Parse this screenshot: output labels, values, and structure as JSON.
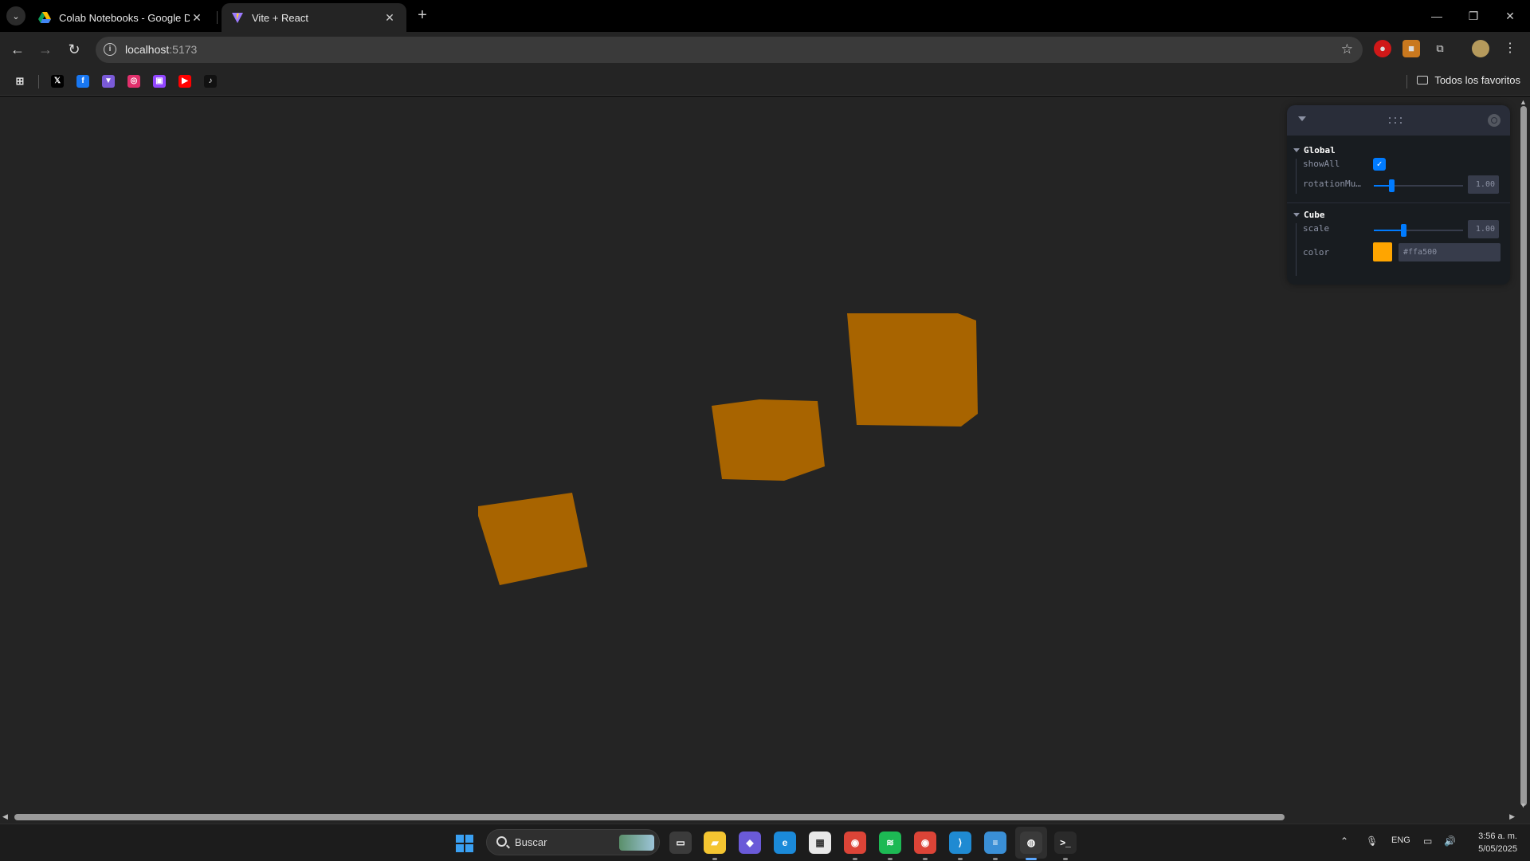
{
  "browser": {
    "tabs": [
      {
        "label": "Colab Notebooks - Google Dri",
        "icon": "google-drive-icon",
        "active": false
      },
      {
        "label": "Vite + React",
        "icon": "vite-icon",
        "active": true
      }
    ],
    "tab_close": "✕",
    "new_tab": "+",
    "window": {
      "minimize": "—",
      "restore": "❐",
      "close": "✕"
    },
    "url_host": "localhost",
    "url_port": ":5173",
    "bookmarks_folder": "Todos los favoritos",
    "bookmarks": [
      {
        "name": "X",
        "icon": "x-icon",
        "color": "#000000",
        "glyph": "𝕏"
      },
      {
        "name": "Facebook",
        "icon": "facebook-icon",
        "color": "#1877f2",
        "glyph": "f"
      },
      {
        "name": "Vimeo-like",
        "icon": "triangle-app-icon",
        "color": "#7a5ad8",
        "glyph": "▼"
      },
      {
        "name": "Instagram",
        "icon": "instagram-icon",
        "color": "#e1306c",
        "glyph": "◎"
      },
      {
        "name": "Twitch",
        "icon": "twitch-icon",
        "color": "#9146ff",
        "glyph": "▣"
      },
      {
        "name": "YouTube",
        "icon": "youtube-icon",
        "color": "#ff0000",
        "glyph": "▶"
      },
      {
        "name": "TikTok",
        "icon": "tiktok-icon",
        "color": "#111111",
        "glyph": "♪"
      }
    ]
  },
  "scene": {
    "cube_color": "#a86400",
    "background": "#242424"
  },
  "leva": {
    "folders": [
      {
        "title": "Global",
        "rows": [
          {
            "label": "showAll",
            "type": "checkbox",
            "checked": true
          },
          {
            "label": "rotationMu…",
            "type": "slider",
            "value": "1.00",
            "fraction": 0.2
          }
        ]
      },
      {
        "title": "Cube",
        "rows": [
          {
            "label": "scale",
            "type": "slider",
            "value": "1.00",
            "fraction": 0.33
          },
          {
            "label": "color",
            "type": "color",
            "value": "#ffa500"
          }
        ]
      }
    ],
    "accent": "#007bff"
  },
  "taskbar": {
    "search_label": "Buscar",
    "apps": [
      {
        "name": "task-view",
        "icon": "task-view-icon",
        "color": "#3b3b3b",
        "glyph": "▭"
      },
      {
        "name": "file-explorer",
        "icon": "folder-icon",
        "color": "#f4c531",
        "glyph": "▰"
      },
      {
        "name": "copilot",
        "icon": "copilot-icon",
        "color": "#6a5ad8",
        "glyph": "◆"
      },
      {
        "name": "edge",
        "icon": "edge-icon",
        "color": "#1b8ad9",
        "glyph": "e"
      },
      {
        "name": "store",
        "icon": "store-icon",
        "color": "#e8e8e8",
        "glyph": "▦"
      },
      {
        "name": "chrome",
        "icon": "chrome-icon",
        "color": "#dc4437",
        "glyph": "◉"
      },
      {
        "name": "spotify",
        "icon": "spotify-icon",
        "color": "#1db954",
        "glyph": "≋"
      },
      {
        "name": "chrome-2",
        "icon": "chrome-icon",
        "color": "#dc4437",
        "glyph": "◉"
      },
      {
        "name": "vscode",
        "icon": "vscode-icon",
        "color": "#1f8ad2",
        "glyph": "⟩"
      },
      {
        "name": "notepad",
        "icon": "notepad-icon",
        "color": "#3a8fd6",
        "glyph": "≡"
      },
      {
        "name": "obs",
        "icon": "obs-icon",
        "color": "#3a3a3a",
        "glyph": "◍"
      },
      {
        "name": "terminal",
        "icon": "terminal-icon",
        "color": "#2a2a2a",
        "glyph": ">_"
      }
    ],
    "tray": {
      "lang": "ENG"
    },
    "time": "3:56 a. m.",
    "date": "5/05/2025"
  }
}
